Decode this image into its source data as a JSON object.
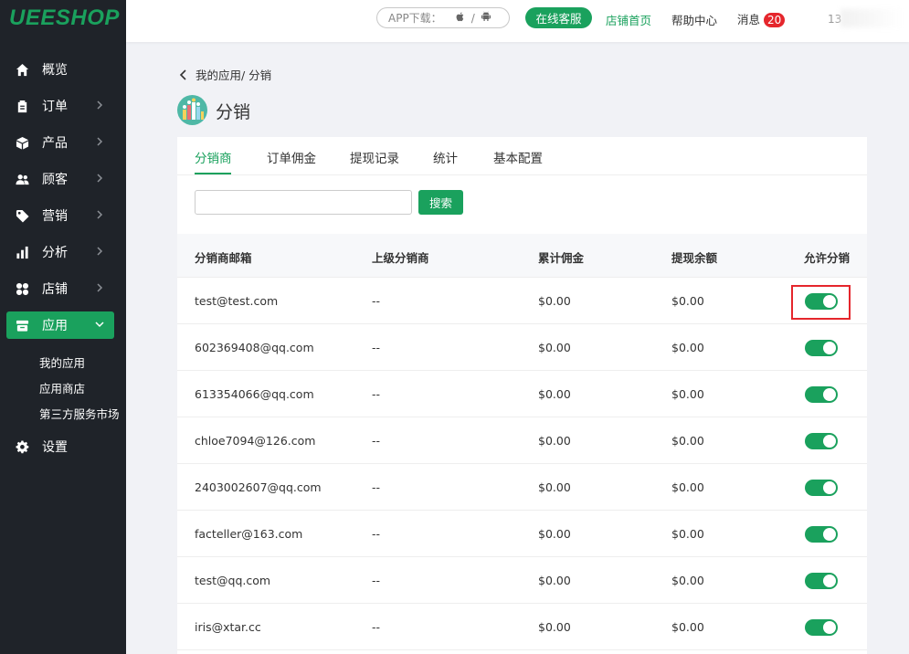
{
  "logo": "UEESHOP",
  "header": {
    "app_download": "APP下载：",
    "app_sep": "/",
    "online_service": "在线客服",
    "store_home": "店铺首页",
    "help_center": "帮助中心",
    "messages": "消息",
    "message_count": "20",
    "user_partial": "13",
    "colors": {
      "accent": "#1aa15d",
      "badge": "#e5262c"
    }
  },
  "sidebar": {
    "items": [
      {
        "label": "概览",
        "icon": "home-icon"
      },
      {
        "label": "订单",
        "icon": "clipboard-icon"
      },
      {
        "label": "产品",
        "icon": "box-icon"
      },
      {
        "label": "顾客",
        "icon": "users-icon"
      },
      {
        "label": "营销",
        "icon": "tag-icon"
      },
      {
        "label": "分析",
        "icon": "bar-chart-icon"
      },
      {
        "label": "店铺",
        "icon": "grid-icon"
      },
      {
        "label": "应用",
        "icon": "app-icon"
      },
      {
        "label": "设置",
        "icon": "gear-icon"
      }
    ],
    "sub_items": [
      "我的应用",
      "应用商店",
      "第三方服务市场"
    ]
  },
  "breadcrumb": "我的应用/ 分销",
  "page_title": "分销",
  "tabs": [
    "分销商",
    "订单佣金",
    "提现记录",
    "统计",
    "基本配置"
  ],
  "search": {
    "placeholder": "",
    "button": "搜索"
  },
  "table": {
    "columns": [
      "分销商邮箱",
      "上级分销商",
      "累计佣金",
      "提现余额",
      "允许分销"
    ],
    "rows": [
      {
        "email": "test@test.com",
        "parent": "--",
        "commission": "$0.00",
        "balance": "$0.00",
        "allowed": true
      },
      {
        "email": "602369408@qq.com",
        "parent": "--",
        "commission": "$0.00",
        "balance": "$0.00",
        "allowed": true
      },
      {
        "email": "613354066@qq.com",
        "parent": "--",
        "commission": "$0.00",
        "balance": "$0.00",
        "allowed": true
      },
      {
        "email": "chloe7094@126.com",
        "parent": "--",
        "commission": "$0.00",
        "balance": "$0.00",
        "allowed": true
      },
      {
        "email": "2403002607@qq.com",
        "parent": "--",
        "commission": "$0.00",
        "balance": "$0.00",
        "allowed": true
      },
      {
        "email": "facteller@163.com",
        "parent": "--",
        "commission": "$0.00",
        "balance": "$0.00",
        "allowed": true
      },
      {
        "email": "test@qq.com",
        "parent": "--",
        "commission": "$0.00",
        "balance": "$0.00",
        "allowed": true
      },
      {
        "email": "iris@xtar.cc",
        "parent": "--",
        "commission": "$0.00",
        "balance": "$0.00",
        "allowed": true
      }
    ]
  }
}
